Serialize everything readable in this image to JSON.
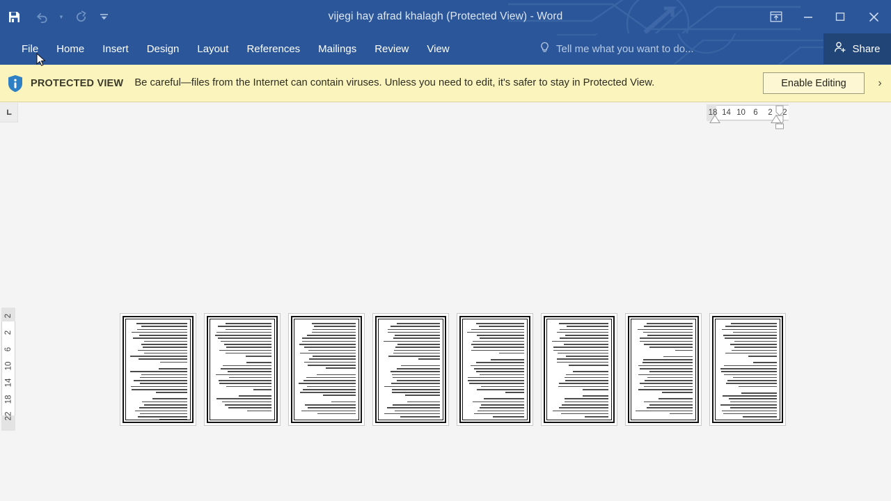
{
  "titlebar": {
    "document_title": "vijegi hay afrad khalagh (Protected View) - Word",
    "quick_access": [
      {
        "name": "save",
        "icon": "save-icon",
        "enabled": true
      },
      {
        "name": "undo",
        "icon": "undo-icon",
        "enabled": false
      },
      {
        "name": "redo",
        "icon": "redo-icon",
        "enabled": false
      },
      {
        "name": "customize-quick-access-toolbar",
        "icon": "chevron-down-icon",
        "enabled": true
      }
    ],
    "window_controls": [
      {
        "name": "ribbon-display-options",
        "icon": "ribbon-display-icon"
      },
      {
        "name": "minimize",
        "icon": "minimize-icon"
      },
      {
        "name": "restore",
        "icon": "restore-icon"
      },
      {
        "name": "close",
        "icon": "close-icon"
      }
    ],
    "accent_color": "#2b579a"
  },
  "ribbon": {
    "tabs": [
      {
        "label": "File",
        "active": false
      },
      {
        "label": "Home",
        "active": false
      },
      {
        "label": "Insert",
        "active": false
      },
      {
        "label": "Design",
        "active": false
      },
      {
        "label": "Layout",
        "active": false
      },
      {
        "label": "References",
        "active": false
      },
      {
        "label": "Mailings",
        "active": false
      },
      {
        "label": "Review",
        "active": false
      },
      {
        "label": "View",
        "active": false
      }
    ],
    "tell_me_placeholder": "Tell me what you want to do...",
    "share_label": "Share"
  },
  "protected_view": {
    "badge": "PROTECTED VIEW",
    "message": "Be careful—files from the Internet can contain viruses. Unless you need to edit, it's safer to stay in Protected View.",
    "enable_editing_label": "Enable Editing",
    "close_label": "›",
    "background_color": "#fbf4bd"
  },
  "rulers": {
    "tab_stop_marker": "left-tab-stop",
    "horizontal_ticks": [
      "18",
      "14",
      "10",
      "6",
      "2",
      "2"
    ],
    "vertical_ticks": [
      "2",
      "2",
      "6",
      "10",
      "14",
      "18",
      "22"
    ],
    "unit_direction": "right-to-left"
  },
  "document": {
    "view_mode": "multiple-pages",
    "page_count": 8,
    "text_direction": "rtl",
    "pages": [
      {
        "page_number": 1,
        "line_counts": [
          14,
          9,
          8
        ]
      },
      {
        "page_number": 2,
        "line_counts": [
          12,
          10,
          6
        ]
      },
      {
        "page_number": 3,
        "line_counts": [
          16,
          8,
          5
        ]
      },
      {
        "page_number": 4,
        "line_counts": [
          13,
          11,
          6
        ]
      },
      {
        "page_number": 5,
        "line_counts": [
          11,
          12,
          7
        ]
      },
      {
        "page_number": 6,
        "line_counts": [
          15,
          7,
          8
        ]
      },
      {
        "page_number": 7,
        "line_counts": [
          10,
          13,
          6
        ]
      },
      {
        "page_number": 8,
        "line_counts": [
          12,
          9,
          9
        ]
      }
    ]
  }
}
